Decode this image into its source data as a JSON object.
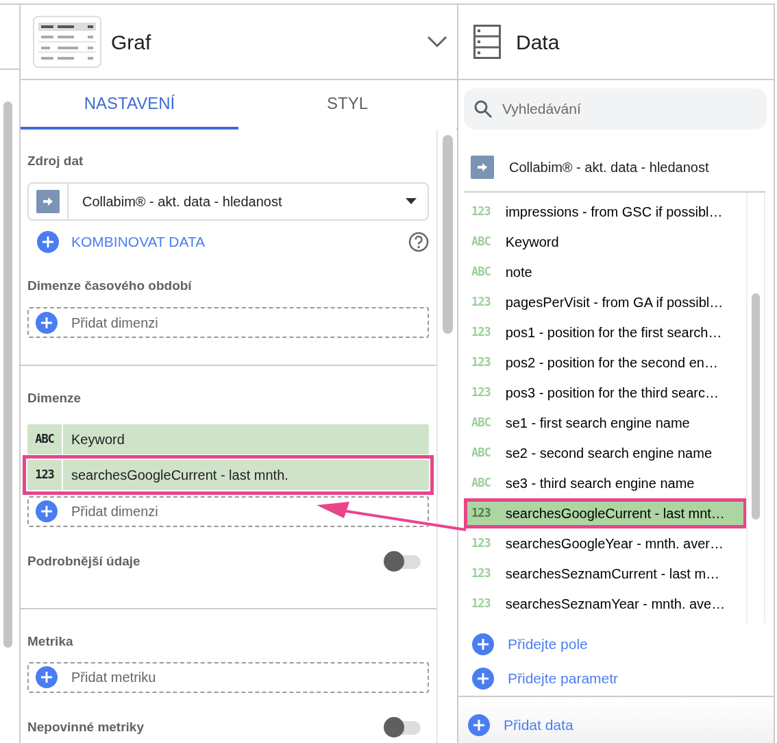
{
  "chart_panel": {
    "title": "Graf",
    "tabs": [
      {
        "label": "NASTAVENÍ",
        "selected": true
      },
      {
        "label": "STYL",
        "selected": false
      }
    ],
    "data_source": {
      "label": "Zdroj dat",
      "value": "Collabim® - akt. data - hledanost",
      "blend_link": "KOMBINOVAT DATA"
    },
    "date_dimension": {
      "label": "Dimenze časového období",
      "add_placeholder": "Přidat dimenzi"
    },
    "dimensions": {
      "label": "Dimenze",
      "items": [
        {
          "type_label": "ABC",
          "name": "Keyword",
          "highlighted": false
        },
        {
          "type_label": "123",
          "name": "searchesGoogleCurrent - last mnth.",
          "highlighted": true
        }
      ],
      "add_placeholder": "Přidat dimenzi"
    },
    "drill_down": {
      "label": "Podrobnější údaje",
      "on": false
    },
    "metrics": {
      "label": "Metrika",
      "add_placeholder": "Přidat metriku"
    },
    "optional_metrics": {
      "label": "Nepovinné metriky",
      "on": false
    }
  },
  "data_panel": {
    "title": "Data",
    "search": {
      "placeholder": "Vyhledávání"
    },
    "source": "Collabim® - akt. data - hledanost",
    "fields": [
      {
        "type_label": "123",
        "name": "impressions - from GSC if possibl…",
        "selected": false,
        "highlighted": false
      },
      {
        "type_label": "ABC",
        "name": "Keyword",
        "selected": false,
        "highlighted": false
      },
      {
        "type_label": "ABC",
        "name": "note",
        "selected": false,
        "highlighted": false
      },
      {
        "type_label": "123",
        "name": "pagesPerVisit - from GA if possibl…",
        "selected": false,
        "highlighted": false
      },
      {
        "type_label": "123",
        "name": "pos1 - position for the first search…",
        "selected": false,
        "highlighted": false
      },
      {
        "type_label": "123",
        "name": "pos2 - position for the second en…",
        "selected": false,
        "highlighted": false
      },
      {
        "type_label": "123",
        "name": "pos3 - position for the third searc…",
        "selected": false,
        "highlighted": false
      },
      {
        "type_label": "ABC",
        "name": "se1 - first search engine name",
        "selected": false,
        "highlighted": false
      },
      {
        "type_label": "ABC",
        "name": "se2 - second search engine name",
        "selected": false,
        "highlighted": false
      },
      {
        "type_label": "ABC",
        "name": "se3 - third search engine name",
        "selected": false,
        "highlighted": false
      },
      {
        "type_label": "123",
        "name": "searchesGoogleCurrent - last mnt…",
        "selected": true,
        "highlighted": true
      },
      {
        "type_label": "123",
        "name": "searchesGoogleYear - mnth. aver…",
        "selected": false,
        "highlighted": false
      },
      {
        "type_label": "123",
        "name": "searchesSeznamCurrent - last m…",
        "selected": false,
        "highlighted": false
      },
      {
        "type_label": "123",
        "name": "searchesSeznamYear - mnth. ave…",
        "selected": false,
        "highlighted": false
      }
    ],
    "links": [
      "Přidejte pole",
      "Přidejte parametr"
    ],
    "add_data": "Přidat data"
  }
}
